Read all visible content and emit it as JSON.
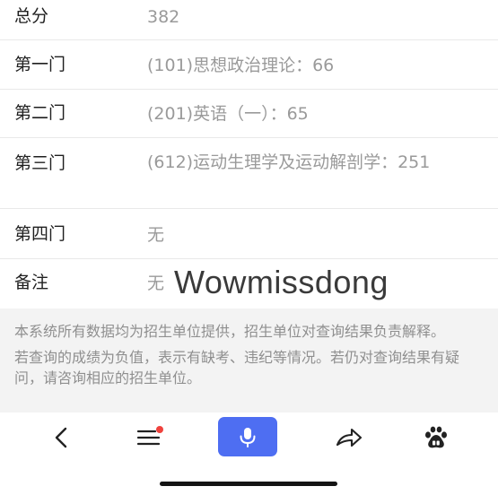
{
  "scores": [
    {
      "label": "总分",
      "value": "382"
    },
    {
      "label": "第一门",
      "value": "(101)思想政治理论：66"
    },
    {
      "label": "第二门",
      "value": "(201)英语（一）：65"
    },
    {
      "label": "第三门",
      "value": "(612)运动生理学及运动解剖学：251"
    },
    {
      "label": "第四门",
      "value": "无"
    },
    {
      "label": "备注",
      "value": "无"
    }
  ],
  "watermark": "Wowmissdong",
  "notice": {
    "line1": "本系统所有数据均为招生单位提供，招生单位对查询结果负责解释。",
    "line2": "若查询的成绩为负值，表示有缺考、违纪等情况。若仍对查询结果有疑问，请咨询相应的招生单位。"
  },
  "colors": {
    "accent": "#4e6ef2",
    "badge": "#f0423d",
    "notice_bg": "#f3f3f3"
  },
  "toolbar_icons": [
    "back-icon",
    "menu-icon",
    "microphone-icon",
    "share-icon",
    "baidu-icon"
  ]
}
